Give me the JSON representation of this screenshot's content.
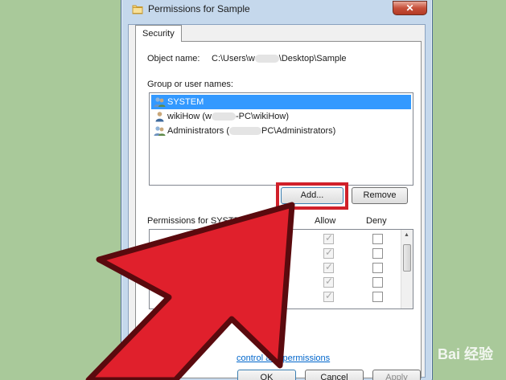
{
  "window": {
    "title": "Permissions for Sample",
    "close_label": "✕"
  },
  "tabs": [
    {
      "label": "Security"
    }
  ],
  "object": {
    "label": "Object name:",
    "path_prefix": "C:\\Users\\w",
    "path_suffix": "\\Desktop\\Sample"
  },
  "groups": {
    "label": "Group or user names:",
    "users": [
      {
        "name": "SYSTEM",
        "selected": true
      },
      {
        "prefix": "wikiHow (w",
        "suffix": "-PC\\wikiHow)",
        "selected": false
      },
      {
        "prefix": "Administrators (",
        "suffix": "PC\\Administrators)",
        "selected": false
      }
    ]
  },
  "buttons": {
    "add": "Add...",
    "remove": "Remove",
    "ok": "OK",
    "cancel": "Cancel",
    "apply": "Apply"
  },
  "permissions": {
    "header": "Permissions for SYSTEM",
    "allow_header": "Allow",
    "deny_header": "Deny",
    "rows": [
      {
        "allow": true,
        "deny": false
      },
      {
        "allow": true,
        "deny": false
      },
      {
        "allow": true,
        "deny": false
      },
      {
        "allow": true,
        "deny": false
      },
      {
        "allow": true,
        "deny": false
      }
    ]
  },
  "advanced_link": "control and permissions",
  "watermark": "Bai 经验",
  "colors": {
    "background": "#a9c99a",
    "highlight_box": "#d0202a",
    "arrow_fill": "#e0202c",
    "selection": "#3399ff"
  }
}
